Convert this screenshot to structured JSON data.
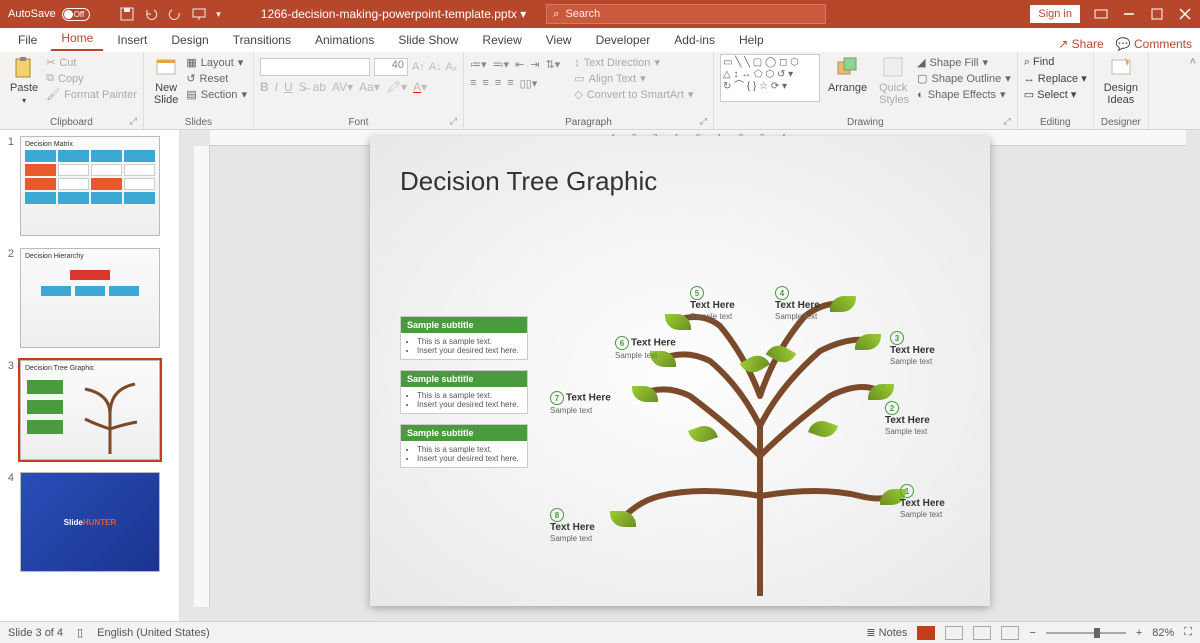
{
  "titlebar": {
    "autosave_label": "AutoSave",
    "autosave_state": "Off",
    "filename": "1266-decision-making-powerpoint-template.pptx",
    "search_placeholder": "Search",
    "signin": "Sign in"
  },
  "tabs": {
    "file": "File",
    "home": "Home",
    "insert": "Insert",
    "design": "Design",
    "transitions": "Transitions",
    "animations": "Animations",
    "slideshow": "Slide Show",
    "review": "Review",
    "view": "View",
    "developer": "Developer",
    "addins": "Add-ins",
    "help": "Help",
    "share": "Share",
    "comments": "Comments"
  },
  "ribbon": {
    "clipboard": {
      "paste": "Paste",
      "cut": "Cut",
      "copy": "Copy",
      "format_painter": "Format Painter",
      "label": "Clipboard"
    },
    "slides": {
      "new_slide": "New\nSlide",
      "layout": "Layout",
      "reset": "Reset",
      "section": "Section",
      "label": "Slides"
    },
    "font": {
      "size": "40",
      "label": "Font"
    },
    "paragraph": {
      "text_direction": "Text Direction",
      "align_text": "Align Text",
      "convert": "Convert to SmartArt",
      "label": "Paragraph"
    },
    "drawing": {
      "arrange": "Arrange",
      "quick_styles": "Quick\nStyles",
      "shape_fill": "Shape Fill",
      "shape_outline": "Shape Outline",
      "shape_effects": "Shape Effects",
      "label": "Drawing"
    },
    "editing": {
      "find": "Find",
      "replace": "Replace",
      "select": "Select",
      "label": "Editing"
    },
    "ideas": {
      "design_ideas": "Design\nIdeas",
      "label": "Designer"
    }
  },
  "thumbs": [
    {
      "num": "1",
      "title": "Decision Matrix"
    },
    {
      "num": "2",
      "title": "Decision Hierarchy"
    },
    {
      "num": "3",
      "title": "Decision Tree Graphic"
    },
    {
      "num": "4",
      "title": ""
    }
  ],
  "slide": {
    "title": "Decision Tree Graphic",
    "cards": [
      {
        "header": "Sample subtitle",
        "l1": "This is a sample text.",
        "l2": "Insert your desired text here."
      },
      {
        "header": "Sample subtitle",
        "l1": "This is a sample text.",
        "l2": "Insert your desired text here."
      },
      {
        "header": "Sample subtitle",
        "l1": "This is a sample text.",
        "l2": "Insert your desired text here."
      }
    ],
    "nodes": [
      {
        "n": "1",
        "h": "Text Here",
        "s": "Sample text"
      },
      {
        "n": "2",
        "h": "Text Here",
        "s": "Sample text"
      },
      {
        "n": "3",
        "h": "Text Here",
        "s": "Sample text"
      },
      {
        "n": "4",
        "h": "Text Here",
        "s": "Sample text"
      },
      {
        "n": "5",
        "h": "Text Here",
        "s": "Sample text"
      },
      {
        "n": "6",
        "h": "Text Here",
        "s": "Sample text"
      },
      {
        "n": "7",
        "h": "Text Here",
        "s": "Sample text"
      },
      {
        "n": "8",
        "h": "Text Here",
        "s": "Sample text"
      }
    ]
  },
  "status": {
    "slide_info": "Slide 3 of 4",
    "language": "English (United States)",
    "notes": "Notes",
    "zoom": "82%"
  }
}
